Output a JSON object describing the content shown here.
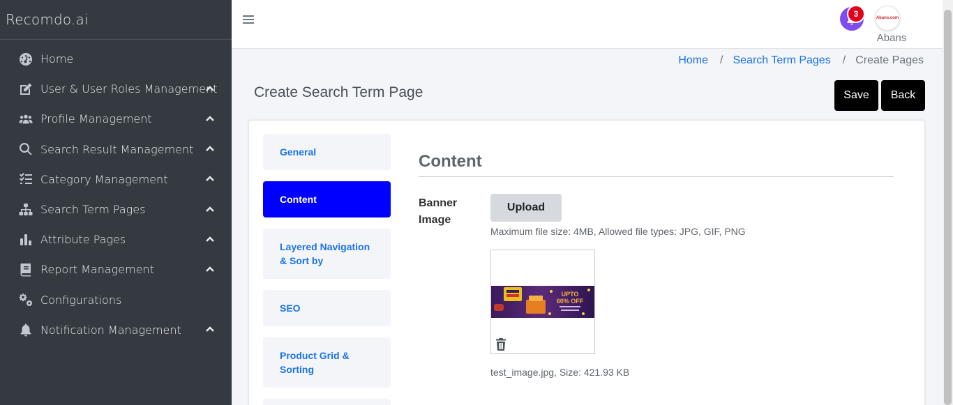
{
  "brand": "Recomdo.ai",
  "sidebar": {
    "items": [
      {
        "label": "Home",
        "icon": "dashboard-icon",
        "expandable": false
      },
      {
        "label": "User & User Roles Management",
        "icon": "edit-icon",
        "expandable": true
      },
      {
        "label": "Profile Management",
        "icon": "users-icon",
        "expandable": true
      },
      {
        "label": "Search Result Management",
        "icon": "search-icon",
        "expandable": true
      },
      {
        "label": "Category Management",
        "icon": "list-check-icon",
        "expandable": true
      },
      {
        "label": "Search Term Pages",
        "icon": "sitemap-icon",
        "expandable": true
      },
      {
        "label": "Attribute Pages",
        "icon": "bar-chart-icon",
        "expandable": true
      },
      {
        "label": "Report Management",
        "icon": "book-icon",
        "expandable": true
      },
      {
        "label": "Configurations",
        "icon": "gears-icon",
        "expandable": false
      },
      {
        "label": "Notification Management",
        "icon": "bell-icon",
        "expandable": true
      }
    ]
  },
  "header": {
    "notification_count": "3",
    "user_name": "Abans",
    "avatar_logo": "Abans.com"
  },
  "breadcrumb": {
    "home": "Home",
    "parent": "Search Term Pages",
    "current": "Create Pages",
    "separator": "/"
  },
  "page": {
    "title": "Create Search Term Page",
    "save_label": "Save",
    "back_label": "Back"
  },
  "tabs": [
    {
      "label": "General",
      "active": false
    },
    {
      "label": "Content",
      "active": true
    },
    {
      "label": "Layered Navigation & Sort by",
      "active": false
    },
    {
      "label": "SEO",
      "active": false
    },
    {
      "label": "Product Grid & Sorting",
      "active": false
    }
  ],
  "content": {
    "heading": "Content",
    "banner_label": "Banner Image",
    "upload_label": "Upload",
    "hint": "Maximum file size: 4MB, Allowed file types: JPG, GIF, PNG",
    "banner_text_1": "UPTO",
    "banner_text_2": "60% OFF",
    "file_info": "test_image.jpg, Size: 421.93 KB"
  },
  "colors": {
    "sidebar_bg": "#343a40",
    "active_tab": "#0000ff",
    "link": "#1a73e8",
    "notification_bell": "#7e4cf0",
    "badge": "#e3001b"
  }
}
